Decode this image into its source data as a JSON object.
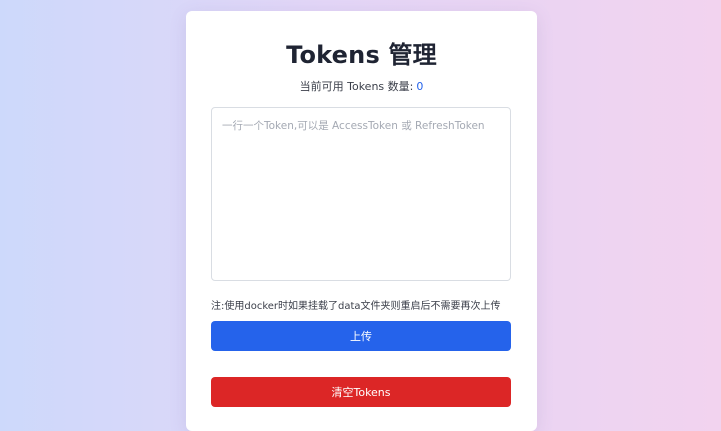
{
  "header": {
    "title": "Tokens 管理"
  },
  "status": {
    "count_label": "当前可用 Tokens 数量:",
    "count_value": "0"
  },
  "form": {
    "textarea_placeholder": "一行一个Token,可以是 AccessToken 或 RefreshToken",
    "textarea_value": "",
    "note": "注:使用docker时如果挂载了data文件夹则重启后不需要再次上传",
    "upload_label": "上传",
    "clear_label": "清空Tokens"
  },
  "colors": {
    "primary": "#2563eb",
    "danger": "#dc2626",
    "count_value": "#2563eb"
  }
}
